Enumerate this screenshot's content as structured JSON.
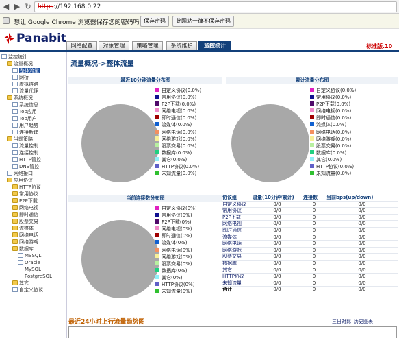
{
  "browser": {
    "url_scheme": "https",
    "url_rest": "://192.168.0.22",
    "password_prompt": "想让 Google Chrome 浏览器保存您的密码吗？",
    "save_label": "保存密码",
    "never_label": "此网站一律不保存密码"
  },
  "app": {
    "logo": "Panabit",
    "version": "标准版.10",
    "tabs": [
      "网络配置",
      "对象管理",
      "策略管理",
      "系统维护",
      "监控统计"
    ],
    "active_tab": 4
  },
  "tree": [
    {
      "label": "监控统计",
      "icon": "page",
      "level": 0
    },
    {
      "label": "流量概况",
      "icon": "folder",
      "level": 1
    },
    {
      "label": "整体流量",
      "icon": "page",
      "level": 2,
      "selected": true
    },
    {
      "label": "网桥",
      "icon": "page",
      "level": 2
    },
    {
      "label": "虚拟链路",
      "icon": "page",
      "level": 2
    },
    {
      "label": "流量代理",
      "icon": "page",
      "level": 2
    },
    {
      "label": "系统概况",
      "icon": "folder",
      "level": 1
    },
    {
      "label": "系统信息",
      "icon": "page",
      "level": 2
    },
    {
      "label": "Top应用",
      "icon": "page",
      "level": 2
    },
    {
      "label": "Top用户",
      "icon": "page",
      "level": 2
    },
    {
      "label": "用户趋势",
      "icon": "page",
      "level": 2
    },
    {
      "label": "连接新建",
      "icon": "page",
      "level": 2
    },
    {
      "label": "当前策略",
      "icon": "folder",
      "level": 1
    },
    {
      "label": "流量控制",
      "icon": "page",
      "level": 2
    },
    {
      "label": "连接控制",
      "icon": "page",
      "level": 2
    },
    {
      "label": "HTTP管控",
      "icon": "page",
      "level": 2
    },
    {
      "label": "DNS管控",
      "icon": "page",
      "level": 2
    },
    {
      "label": "网络接口",
      "icon": "page",
      "level": 1
    },
    {
      "label": "应用协议",
      "icon": "folder",
      "level": 1
    },
    {
      "label": "HTTP协议",
      "icon": "folder",
      "level": 2
    },
    {
      "label": "常用协议",
      "icon": "folder",
      "level": 2
    },
    {
      "label": "P2P下载",
      "icon": "folder",
      "level": 2
    },
    {
      "label": "网络电视",
      "icon": "folder",
      "level": 2
    },
    {
      "label": "即时通信",
      "icon": "folder",
      "level": 2
    },
    {
      "label": "股票交易",
      "icon": "folder",
      "level": 2
    },
    {
      "label": "流媒体",
      "icon": "folder",
      "level": 2
    },
    {
      "label": "网络电话",
      "icon": "folder",
      "level": 2
    },
    {
      "label": "网络游戏",
      "icon": "folder",
      "level": 2
    },
    {
      "label": "数据库",
      "icon": "folder",
      "level": 2
    },
    {
      "label": "MSSQL",
      "icon": "page",
      "level": 3
    },
    {
      "label": "Oracle",
      "icon": "page",
      "level": 3
    },
    {
      "label": "MySQL",
      "icon": "page",
      "level": 3
    },
    {
      "label": "PostgreSQL",
      "icon": "page",
      "level": 3
    },
    {
      "label": "其它",
      "icon": "folder",
      "level": 2
    },
    {
      "label": "自定义协议",
      "icon": "page",
      "level": 2
    }
  ],
  "content": {
    "title": "流量概况->整体流量",
    "panel1_title": "最近10分钟流量分布图",
    "panel2_title": "累计流量分布图",
    "panel3_title": "当前连接数分布图",
    "trend_title": "最近24小时上行流量趋势图",
    "link_3day": "三日对比",
    "link_history": "历史图表"
  },
  "colors": {
    "pie": "#a8a8a8",
    "accent": "#13407a"
  },
  "legend_colors": [
    "#e020c0",
    "#101090",
    "#500a6a",
    "#f088c8",
    "#a00000",
    "#1060d0",
    "#f49060",
    "#f8f098",
    "#b8f0a0",
    "#20d080",
    "#90f0f8",
    "#6060c8",
    "#30c030"
  ],
  "legend1": [
    "自定义协议(0.0%)",
    "常用协议(0.0%)",
    "P2P下载(0.0%)",
    "网络电视(0.0%)",
    "即时通信(0.0%)",
    "流媒体(0.0%)",
    "网络电话(0.0%)",
    "网络游戏(0.0%)",
    "股票交易(0.0%)",
    "数据库(0.0%)",
    "其它(0.0%)",
    "HTTP协议(0.0%)",
    "未知流量(0.0%)"
  ],
  "legend2": [
    "自定义协议(0.0%)",
    "常用协议(0.0%)",
    "P2P下载(0.0%)",
    "网络电视(0.0%)",
    "即时通信(0.0%)",
    "流媒体(0.0%)",
    "网络电话(0.0%)",
    "网络游戏(0.0%)",
    "股票交易(0.0%)",
    "数据库(0.0%)",
    "其它(0.0%)",
    "HTTP协议(0.0%)",
    "未知流量(0.0%)"
  ],
  "legend3": [
    "自定义协议(0%)",
    "常用协议(0%)",
    "P2P下载(0%)",
    "网络电视(0%)",
    "即时通信(0%)",
    "流媒体(0%)",
    "网络电话(0%)",
    "网络游戏(0%)",
    "股票交易(0%)",
    "数据库(0%)",
    "其它(0%)",
    "HTTP协议(0%)",
    "未知流量(0%)"
  ],
  "table": {
    "headers": [
      "协议组",
      "流量(10分钟/累计)",
      "连接数",
      "当前bps(up/down)"
    ],
    "rows": [
      [
        "自定义协议",
        "0/0",
        "0",
        "0/0"
      ],
      [
        "常用协议",
        "0/0",
        "0",
        "0/0"
      ],
      [
        "P2P下载",
        "0/0",
        "0",
        "0/0"
      ],
      [
        "网络电视",
        "0/0",
        "0",
        "0/0"
      ],
      [
        "即时通信",
        "0/0",
        "0",
        "0/0"
      ],
      [
        "流媒体",
        "0/0",
        "0",
        "0/0"
      ],
      [
        "网络电话",
        "0/0",
        "0",
        "0/0"
      ],
      [
        "网络游戏",
        "0/0",
        "0",
        "0/0"
      ],
      [
        "股票交易",
        "0/0",
        "0",
        "0/0"
      ],
      [
        "数据库",
        "0/0",
        "0",
        "0/0"
      ],
      [
        "其它",
        "0/0",
        "0",
        "0/0"
      ],
      [
        "HTTP协议",
        "0/0",
        "0",
        "0/0"
      ],
      [
        "未知流量",
        "0/0",
        "0",
        "0/0"
      ],
      [
        "合计",
        "0/0",
        "0",
        "0/0"
      ]
    ]
  }
}
